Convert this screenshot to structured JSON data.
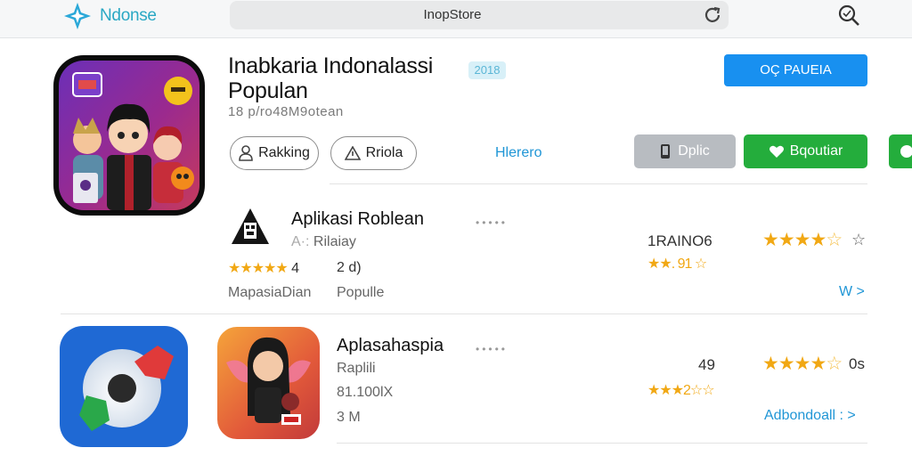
{
  "browser": {
    "brand": "Ndonse",
    "address": "InopStore"
  },
  "hero": {
    "title_line1": "Inabkaria Indonalassi",
    "title_line2": "Populan",
    "year_badge": "2018",
    "subtitle": "18 p/ro48M9otean",
    "primary_button": "OÇ PAUEIA",
    "pill_ranking": "Rakking",
    "pill_priority": "Rriola",
    "link": "Hlerero",
    "grey_button": "Dplic",
    "green_button": "Bqoutiar"
  },
  "rows": [
    {
      "name": "Aplikasi Roblean",
      "dots": "•••••",
      "sub": "Rilaiay",
      "sub_prefix": "A·:",
      "rating_text": "4",
      "count": "2 d)",
      "category": "MapasiaDian",
      "category2": "Populle",
      "code": "1RAINO6",
      "code_rating": "★★. 91 ☆",
      "mini_mark": "☆",
      "link": "W >"
    },
    {
      "name": "Aplasahaspia",
      "dots": "•••••",
      "sub": "Raplili",
      "size": "81.100lX",
      "size2": "3 M",
      "code": "49",
      "code_rating": "★★★2☆☆",
      "rating_value": "0s",
      "link": "Adbondoall : >"
    }
  ],
  "colors": {
    "accent_blue": "#1890f0",
    "green": "#24ad3c",
    "star": "#f1a814"
  }
}
